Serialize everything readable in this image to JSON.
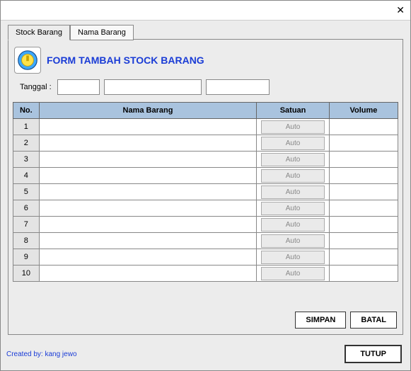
{
  "window": {
    "close_glyph": "✕"
  },
  "tabs": [
    {
      "label": "Stock Barang",
      "active": true
    },
    {
      "label": "Nama Barang",
      "active": false
    }
  ],
  "form": {
    "title": "FORM TAMBAH STOCK BARANG",
    "date_label": "Tanggal :",
    "date1": "",
    "date2": "",
    "date3": ""
  },
  "table": {
    "headers": {
      "no": "No.",
      "nama": "Nama Barang",
      "satuan": "Satuan",
      "volume": "Volume"
    },
    "auto_label": "Auto",
    "rows": [
      {
        "no": "1",
        "nama": "",
        "volume": ""
      },
      {
        "no": "2",
        "nama": "",
        "volume": ""
      },
      {
        "no": "3",
        "nama": "",
        "volume": ""
      },
      {
        "no": "4",
        "nama": "",
        "volume": ""
      },
      {
        "no": "5",
        "nama": "",
        "volume": ""
      },
      {
        "no": "6",
        "nama": "",
        "volume": ""
      },
      {
        "no": "7",
        "nama": "",
        "volume": ""
      },
      {
        "no": "8",
        "nama": "",
        "volume": ""
      },
      {
        "no": "9",
        "nama": "",
        "volume": ""
      },
      {
        "no": "10",
        "nama": "",
        "volume": ""
      }
    ]
  },
  "buttons": {
    "simpan": "SIMPAN",
    "batal": "BATAL",
    "tutup": "TUTUP"
  },
  "footer": {
    "credit": "Created by:  kang jewo"
  }
}
